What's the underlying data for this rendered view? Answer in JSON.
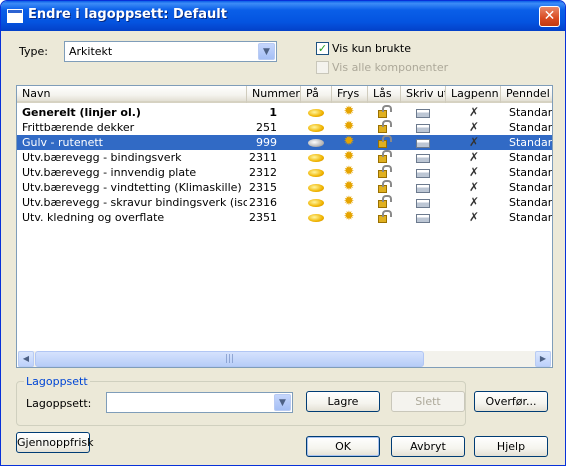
{
  "window": {
    "title": "Endre i lagoppsett: Default"
  },
  "type_filter": {
    "label": "Type:",
    "value": "Arkitekt"
  },
  "checkboxes": {
    "vis_kun_brukte": {
      "label": "Vis kun brukte",
      "checked": true
    },
    "vis_alle_komponenter": {
      "label": "Vis alle komponenter",
      "checked": false,
      "enabled": false
    }
  },
  "columns": [
    "Navn",
    "Nummer",
    "På",
    "Frys",
    "Lås",
    "Skriv ut",
    "Lagpenn",
    "Penndel"
  ],
  "rows": [
    {
      "name": "Generelt (linjer ol.)",
      "number": "1",
      "on": true,
      "pen": "Standard",
      "bold": true,
      "selected": false
    },
    {
      "name": "Frittbærende dekker",
      "number": "251",
      "on": true,
      "pen": "Standard",
      "bold": false,
      "selected": false
    },
    {
      "name": "Gulv - rutenett",
      "number": "999",
      "on": false,
      "pen": "Standard",
      "bold": false,
      "selected": true
    },
    {
      "name": "Utv.bærevegg - bindingsverk",
      "number": "2311",
      "on": true,
      "pen": "Standard",
      "bold": false,
      "selected": false
    },
    {
      "name": "Utv.bærevegg - innvendig plate",
      "number": "2312",
      "on": true,
      "pen": "Standard",
      "bold": false,
      "selected": false
    },
    {
      "name": "Utv.bærevegg - vindtetting (Klimaskille)",
      "number": "2315",
      "on": true,
      "pen": "Standard",
      "bold": false,
      "selected": false
    },
    {
      "name": "Utv.bærevegg - skravur bindingsverk (isolasjo...",
      "number": "2316",
      "on": true,
      "pen": "Standard",
      "bold": false,
      "selected": false
    },
    {
      "name": "Utv. kledning og overflate",
      "number": "2351",
      "on": true,
      "pen": "Standard",
      "bold": false,
      "selected": false
    }
  ],
  "group": {
    "title": "Lagoppsett",
    "label": "Lagoppsett:",
    "value": "",
    "save": "Lagre",
    "delete": "Slett"
  },
  "buttons": {
    "transfer": "Overfør...",
    "refresh": "Gjennoppfrisk",
    "ok": "OK",
    "cancel": "Avbryt",
    "help": "Hjelp"
  }
}
